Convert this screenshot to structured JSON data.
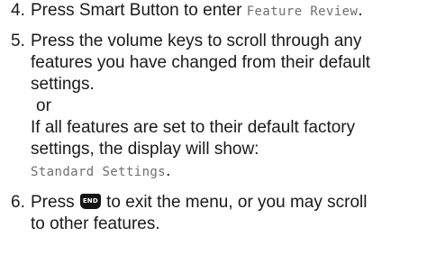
{
  "steps": [
    {
      "number": "4.",
      "text_before": "Press Smart Button to enter ",
      "display_text": "Feature Review",
      "text_after": "."
    },
    {
      "number": "5.",
      "line1": "Press the volume keys to scroll through any",
      "line2": "features you have changed from their default",
      "line3": "settings.",
      "or": "or",
      "line4": "If all features are set to their default factory",
      "line5": "settings, the display will show:",
      "display_text": "Standard Settings",
      "display_after": "."
    },
    {
      "number": "6.",
      "text_before": "Press ",
      "key_icon": "end-key-icon",
      "key_label": "END",
      "text_after": " to exit the menu, or you may scroll",
      "line2": "to other features."
    }
  ]
}
